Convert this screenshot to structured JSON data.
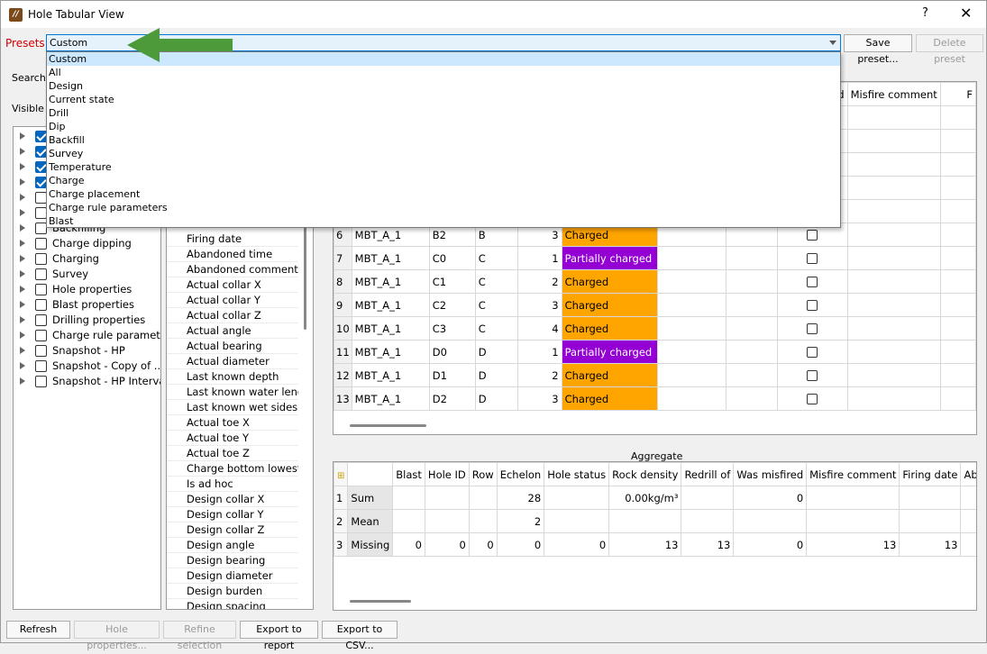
{
  "window": {
    "title": "Hole Tabular View",
    "help": "?",
    "close": "✕"
  },
  "presets": {
    "label": "Presets",
    "value": "Custom",
    "save_button": "Save preset...",
    "delete_button": "Delete preset",
    "options": [
      "Custom",
      "All",
      "Design",
      "Current state",
      "Drill",
      "Dip",
      "Backfill",
      "Survey",
      "Temperature",
      "Charge",
      "Charge placement",
      "Charge rule parameters",
      "Blast"
    ]
  },
  "search": {
    "label": "Search"
  },
  "visible": {
    "label": "Visible c"
  },
  "tree": [
    {
      "label": "",
      "checked": true
    },
    {
      "label": "",
      "checked": true
    },
    {
      "label": "",
      "checked": true
    },
    {
      "label": "",
      "checked": true
    },
    {
      "label": "",
      "checked": false
    },
    {
      "label": "",
      "checked": false
    },
    {
      "label": "Backfilling",
      "checked": false
    },
    {
      "label": "Charge dipping",
      "checked": false
    },
    {
      "label": "Charging",
      "checked": false
    },
    {
      "label": "Survey",
      "checked": false
    },
    {
      "label": "Hole properties",
      "checked": false
    },
    {
      "label": "Blast properties",
      "checked": false
    },
    {
      "label": "Drilling properties",
      "checked": false
    },
    {
      "label": "Charge rule parameter",
      "checked": false
    },
    {
      "label": "Snapshot - HP",
      "checked": false
    },
    {
      "label": "Snapshot - Copy of ...",
      "checked": false
    },
    {
      "label": "Snapshot - HP Interval",
      "checked": false
    }
  ],
  "columns_list": [
    "Firing date",
    "Abandoned time",
    "Abandoned comment",
    "Actual collar X",
    "Actual collar Y",
    "Actual collar Z",
    "Actual angle",
    "Actual bearing",
    "Actual diameter",
    "Last known depth",
    "Last known water lengt",
    "Last known wet sides le",
    "Actual toe X",
    "Actual toe Y",
    "Actual toe Z",
    "Charge bottom lowest d",
    "Is ad hoc",
    "Design collar X",
    "Design collar Y",
    "Design collar Z",
    "Design angle",
    "Design bearing",
    "Design diameter",
    "Design burden",
    "Design spacing"
  ],
  "main_header": {
    "was_misfired": "ed",
    "misfire_comment": "Misfire comment",
    "next": "F"
  },
  "rows": [
    {
      "n": "6",
      "blast": "MBT_A_1",
      "id": "B2",
      "row": "B",
      "ech": "3",
      "status": "Charged",
      "partial": false
    },
    {
      "n": "7",
      "blast": "MBT_A_1",
      "id": "C0",
      "row": "C",
      "ech": "1",
      "status": "Partially charged",
      "partial": true
    },
    {
      "n": "8",
      "blast": "MBT_A_1",
      "id": "C1",
      "row": "C",
      "ech": "2",
      "status": "Charged",
      "partial": false
    },
    {
      "n": "9",
      "blast": "MBT_A_1",
      "id": "C2",
      "row": "C",
      "ech": "3",
      "status": "Charged",
      "partial": false
    },
    {
      "n": "10",
      "blast": "MBT_A_1",
      "id": "C3",
      "row": "C",
      "ech": "4",
      "status": "Charged",
      "partial": false
    },
    {
      "n": "11",
      "blast": "MBT_A_1",
      "id": "D0",
      "row": "D",
      "ech": "1",
      "status": "Partially charged",
      "partial": true
    },
    {
      "n": "12",
      "blast": "MBT_A_1",
      "id": "D1",
      "row": "D",
      "ech": "2",
      "status": "Charged",
      "partial": false
    },
    {
      "n": "13",
      "blast": "MBT_A_1",
      "id": "D2",
      "row": "D",
      "ech": "3",
      "status": "Charged",
      "partial": false
    }
  ],
  "aggregate": {
    "title": "Aggregate",
    "headers": [
      "Blast",
      "Hole ID",
      "Row",
      "Echelon",
      "Hole status",
      "Rock density",
      "Redrill of",
      "Was misfired",
      "Misfire comment",
      "Firing date",
      "Ab"
    ],
    "rows": [
      {
        "n": "1",
        "label": "Sum",
        "values": [
          "",
          "",
          "",
          "28",
          "",
          "0.00kg/m³",
          "",
          "0",
          "",
          "",
          ""
        ]
      },
      {
        "n": "2",
        "label": "Mean",
        "values": [
          "",
          "",
          "",
          "2",
          "",
          "",
          "",
          "",
          "",
          "",
          ""
        ]
      },
      {
        "n": "3",
        "label": "Missing",
        "values": [
          "0",
          "0",
          "0",
          "0",
          "0",
          "13",
          "13",
          "0",
          "13",
          "13",
          ""
        ]
      }
    ]
  },
  "bottom_buttons": {
    "refresh": "Refresh",
    "hole_properties": "Hole properties...",
    "refine": "Refine selection",
    "export_report": "Export to report",
    "export_csv": "Export to CSV..."
  },
  "colors": {
    "charged": "#ffa500",
    "partially_charged": "#9400d3",
    "arrow": "#4c9a3a",
    "accent": "#0078d7"
  }
}
